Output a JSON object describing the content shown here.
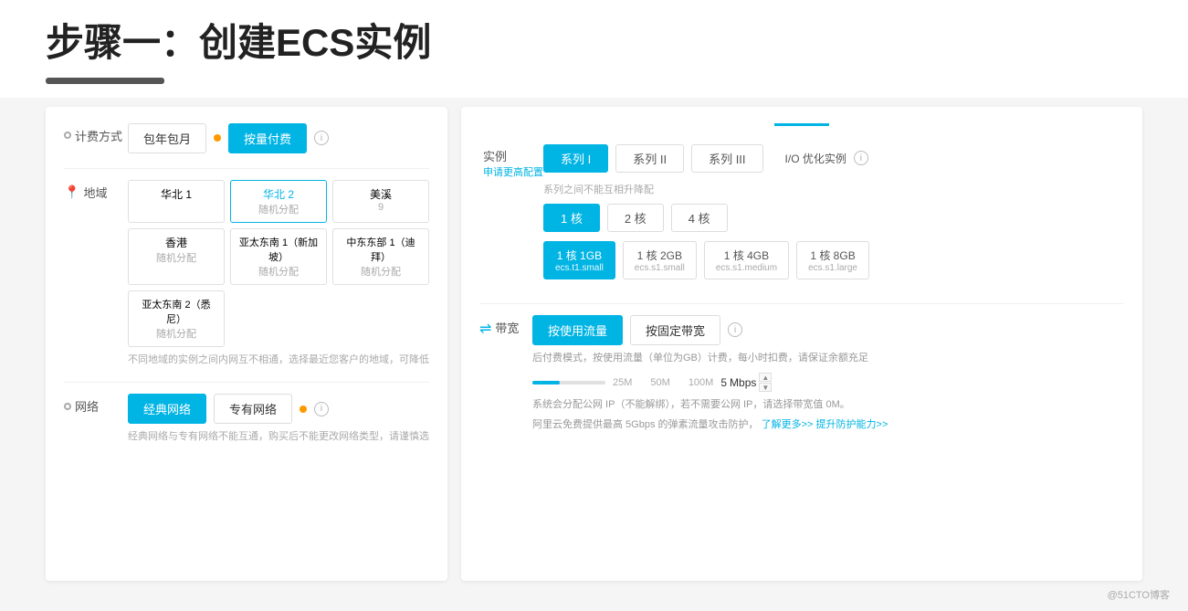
{
  "title": "步骤一：创建ECS实例",
  "left_panel": {
    "billing_label": "计费方式",
    "billing_option1": "包年包月",
    "billing_option2": "按量付费",
    "region_label": "地域",
    "regions": [
      {
        "name": "华北 1",
        "sub": "",
        "selected": false
      },
      {
        "name": "华北 2",
        "sub": "随机分配",
        "selected": true
      },
      {
        "name": "美溪",
        "sub": "",
        "selected": false
      },
      {
        "name": "香港",
        "sub": "随机分配",
        "selected": false
      },
      {
        "name": "亚太东南 1（新加坡）",
        "sub": "随机分配",
        "selected": false
      },
      {
        "name": "中东东部 1（迪拜）",
        "sub": "随机分配",
        "selected": false
      },
      {
        "name": "亚太东南 2（悉尼）",
        "sub": "随机分配",
        "selected": false
      }
    ],
    "region_note": "不同地域的实例之间内网互不相通，选择最近您客户的地域，可降低",
    "network_label": "网络",
    "network_option1": "经典网络",
    "network_option2": "专有网络",
    "network_note": "经典网络与专有网络不能互通，购买后不能更改网络类型，请谨慎选"
  },
  "right_panel": {
    "instance_label": "实例",
    "instance_sub": "申请更高配置",
    "instance_note": "系列之间不能互相升降配",
    "series": [
      {
        "label": "系列 I",
        "active": true
      },
      {
        "label": "系列 II",
        "active": false
      },
      {
        "label": "系列 III",
        "active": false
      }
    ],
    "io_label": "I/O 优化实例",
    "cores": [
      {
        "label": "1 核",
        "active": true
      },
      {
        "label": "2 核",
        "active": false
      },
      {
        "label": "4 核",
        "active": false
      }
    ],
    "specs": [
      {
        "label": "1 核 1GB",
        "sub": "ecs.t1.small",
        "active": true
      },
      {
        "label": "1 核 2GB",
        "sub": "ecs.s1.small",
        "active": false
      },
      {
        "label": "1 核 4GB",
        "sub": "ecs.s1.medium",
        "active": false
      },
      {
        "label": "1 核 8GB",
        "sub": "ecs.s1.large",
        "active": false
      }
    ],
    "bandwidth_label": "带宽",
    "bw_option1": "按使用流量",
    "bw_option2": "按固定带宽",
    "bw_note": "后付费模式，按使用流量（单位为GB）计费，每小时扣费，请保证余额充足",
    "slider_marks": [
      "25M",
      "50M",
      "100M"
    ],
    "slider_value": "5",
    "slider_unit": "Mbps",
    "sys_note": "系统会分配公网 IP（不能解绑），若不需要公网 IP，请选择带宽值 0M。",
    "free_note": "阿里云免费提供最高 5Gbps 的弹素流量攻击防护，了解更多>> 提升防护能力>>"
  },
  "footer": "@51CTO博客"
}
